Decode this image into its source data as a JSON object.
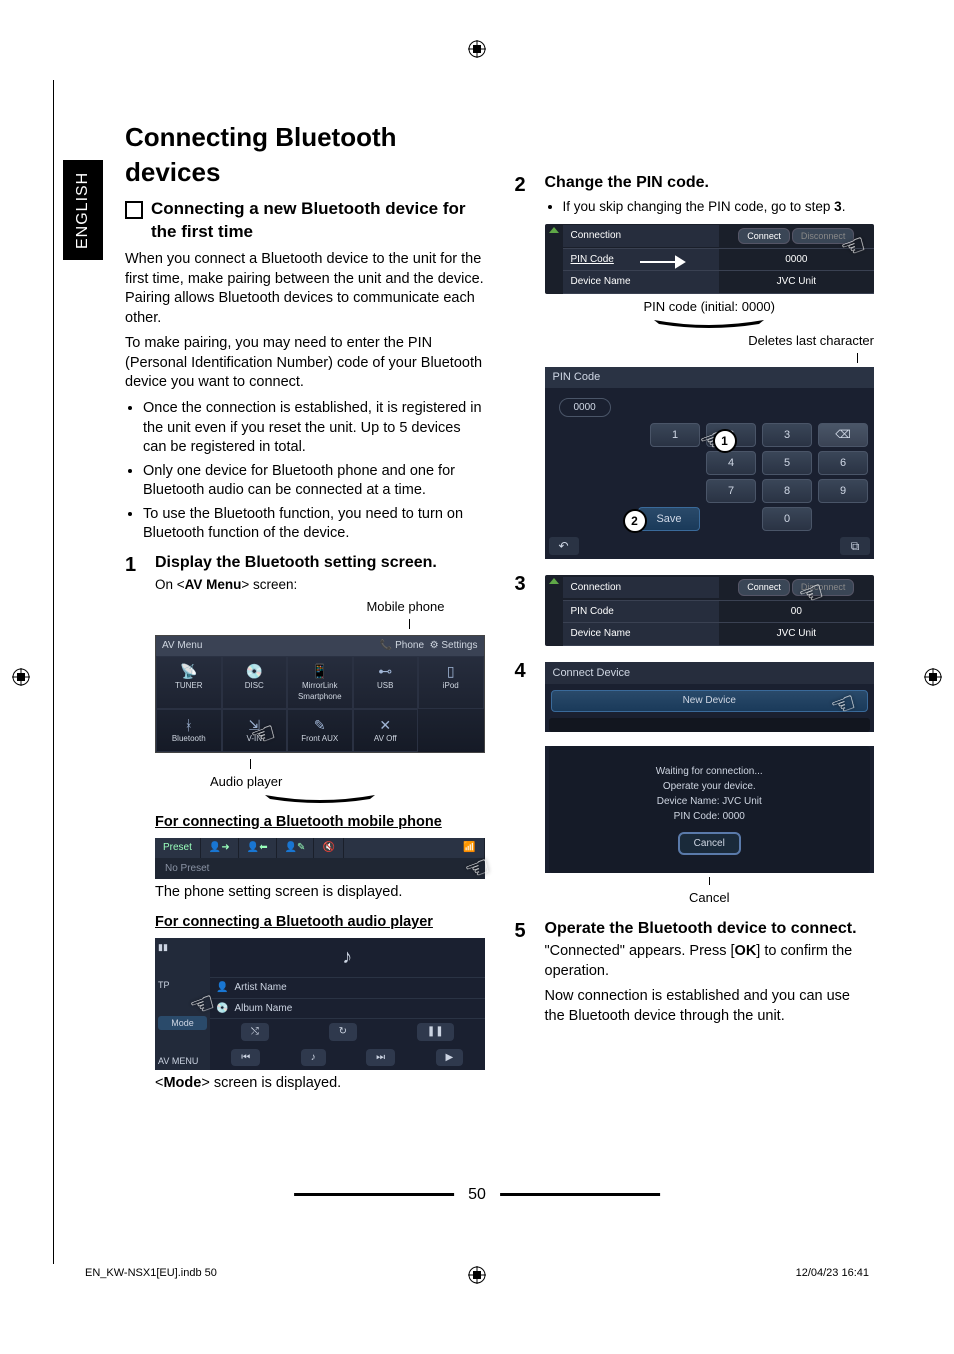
{
  "lang_tab": "ENGLISH",
  "title": "Connecting Bluetooth devices",
  "section_heading": "Connecting a new Bluetooth device for the first time",
  "intro1": "When you connect a Bluetooth device to the unit for the first time, make pairing between the unit and the device. Pairing allows Bluetooth devices to communicate each other.",
  "intro2": "To make pairing, you may need to enter the PIN (Personal Identification Number) code of your Bluetooth device you want to connect.",
  "bullets": [
    "Once the connection is established, it is registered in the unit even if you reset the unit. Up to 5 devices can be registered in total.",
    "Only one device for Bluetooth phone and one for Bluetooth audio can be connected at a time.",
    "To use the Bluetooth function, you need to turn on Bluetooth function of the device."
  ],
  "step1": {
    "num": "1",
    "title": "Display the Bluetooth setting screen.",
    "sub_prefix": "On <",
    "sub_bold": "AV Menu",
    "sub_suffix": "> screen:"
  },
  "labels": {
    "mobile_phone": "Mobile phone",
    "audio_player": "Audio player"
  },
  "avmenu": {
    "title": "AV Menu",
    "phone": "Phone",
    "settings": "Settings",
    "items": [
      "TUNER",
      "DISC",
      "MirrorLink Smartphone",
      "USB",
      "iPod",
      "Bluetooth",
      "V-IN",
      "Front AUX",
      "AV Off"
    ]
  },
  "sub_phone": {
    "heading": "For connecting a Bluetooth mobile phone",
    "preset": "Preset",
    "nopreset": "No Preset",
    "after": "The phone setting screen is displayed."
  },
  "sub_audio": {
    "heading": "For connecting a Bluetooth audio player",
    "player": {
      "tp": "TP",
      "mode": "Mode",
      "avmenu": "AV MENU",
      "artist": "Artist Name",
      "album": "Album Name"
    },
    "after_prefix": "<",
    "after_bold": "Mode",
    "after_suffix": "> screen is displayed."
  },
  "step2": {
    "num": "2",
    "title": "Change the PIN code.",
    "bullet_prefix": "If you skip changing the PIN code, go to step ",
    "bullet_bold": "3",
    "bullet_suffix": ".",
    "scr1": {
      "connection": "Connection",
      "connect": "Connect",
      "disconnect": "Disconnect",
      "pincode": "PIN Code",
      "pinval": "0000",
      "devname": "Device Name",
      "devval": "JVC Unit"
    },
    "cap1": "PIN code (initial: 0000)",
    "cap2": "Deletes last character",
    "keypad": {
      "title": "PIN Code",
      "input": "0000",
      "keys": [
        [
          "1",
          "2",
          "3"
        ],
        [
          "4",
          "5",
          "6"
        ],
        [
          "7",
          "8",
          "9"
        ],
        [
          "",
          "0",
          ""
        ]
      ],
      "save": "Save"
    }
  },
  "step3": {
    "num": "3",
    "scr": {
      "connection": "Connection",
      "connect": "Connect",
      "disconnect": "Disconnect",
      "pincode": "PIN Code",
      "pinval": "00",
      "devname": "Device Name",
      "devval": "JVC Unit"
    }
  },
  "step4": {
    "num": "4",
    "connectdev": {
      "title": "Connect Device",
      "newdev": "New Device",
      "wait1": "Waiting for connection...",
      "wait2": "Operate your device.",
      "wait3": "Device Name: JVC Unit",
      "wait4": "PIN Code: 0000",
      "cancel": "Cancel"
    },
    "caption": "Cancel"
  },
  "step5": {
    "num": "5",
    "title": "Operate the Bluetooth device to connect.",
    "p1a": "\"Connected\" appears. Press [",
    "p1b": "OK",
    "p1c": "] to confirm the operation.",
    "p2": "Now connection is established and you can use the Bluetooth device through the unit."
  },
  "pagenum": "50",
  "footer": {
    "left": "EN_KW-NSX1[EU].indb   50",
    "right": "12/04/23   16:41"
  }
}
